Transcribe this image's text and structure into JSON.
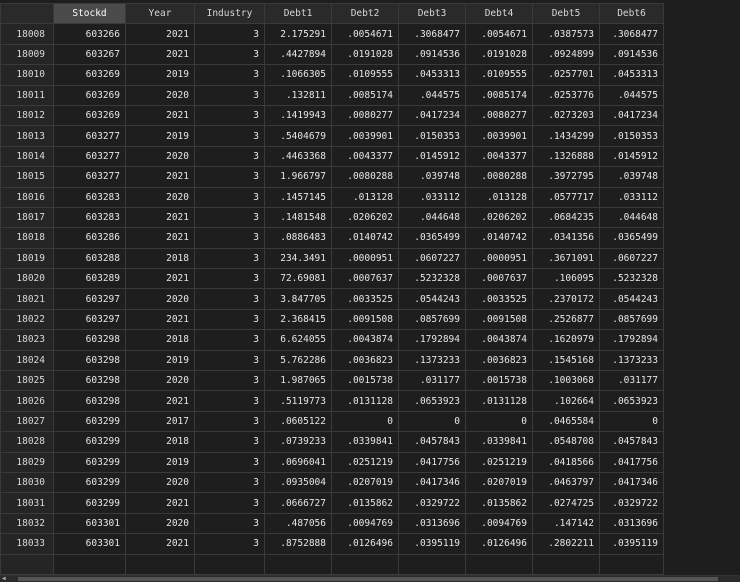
{
  "table": {
    "columns": [
      "",
      "Stockd",
      "Year",
      "Industry",
      "Debt1",
      "Debt2",
      "Debt3",
      "Debt4",
      "Debt5",
      "Debt6"
    ],
    "selected_column": 1,
    "rows": [
      [
        "18008",
        "603266",
        "2021",
        "3",
        "2.175291",
        ".0054671",
        ".3068477",
        ".0054671",
        ".0387573",
        ".3068477"
      ],
      [
        "18009",
        "603267",
        "2021",
        "3",
        ".4427894",
        ".0191028",
        ".0914536",
        ".0191028",
        ".0924899",
        ".0914536"
      ],
      [
        "18010",
        "603269",
        "2019",
        "3",
        ".1066305",
        ".0109555",
        ".0453313",
        ".0109555",
        ".0257701",
        ".0453313"
      ],
      [
        "18011",
        "603269",
        "2020",
        "3",
        ".132811",
        ".0085174",
        ".044575",
        ".0085174",
        ".0253776",
        ".044575"
      ],
      [
        "18012",
        "603269",
        "2021",
        "3",
        ".1419943",
        ".0080277",
        ".0417234",
        ".0080277",
        ".0273203",
        ".0417234"
      ],
      [
        "18013",
        "603277",
        "2019",
        "3",
        ".5404679",
        ".0039901",
        ".0150353",
        ".0039901",
        ".1434299",
        ".0150353"
      ],
      [
        "18014",
        "603277",
        "2020",
        "3",
        ".4463368",
        ".0043377",
        ".0145912",
        ".0043377",
        ".1326888",
        ".0145912"
      ],
      [
        "18015",
        "603277",
        "2021",
        "3",
        "1.966797",
        ".0080288",
        ".039748",
        ".0080288",
        ".3972795",
        ".039748"
      ],
      [
        "18016",
        "603283",
        "2020",
        "3",
        ".1457145",
        ".013128",
        ".033112",
        ".013128",
        ".0577717",
        ".033112"
      ],
      [
        "18017",
        "603283",
        "2021",
        "3",
        ".1481548",
        ".0206202",
        ".044648",
        ".0206202",
        ".0684235",
        ".044648"
      ],
      [
        "18018",
        "603286",
        "2021",
        "3",
        ".0886483",
        ".0140742",
        ".0365499",
        ".0140742",
        ".0341356",
        ".0365499"
      ],
      [
        "18019",
        "603288",
        "2018",
        "3",
        "234.3491",
        ".0000951",
        ".0607227",
        ".0000951",
        ".3671091",
        ".0607227"
      ],
      [
        "18020",
        "603289",
        "2021",
        "3",
        "72.69081",
        ".0007637",
        ".5232328",
        ".0007637",
        ".106095",
        ".5232328"
      ],
      [
        "18021",
        "603297",
        "2020",
        "3",
        "3.847705",
        ".0033525",
        ".0544243",
        ".0033525",
        ".2370172",
        ".0544243"
      ],
      [
        "18022",
        "603297",
        "2021",
        "3",
        "2.368415",
        ".0091508",
        ".0857699",
        ".0091508",
        ".2526877",
        ".0857699"
      ],
      [
        "18023",
        "603298",
        "2018",
        "3",
        "6.624055",
        ".0043874",
        ".1792894",
        ".0043874",
        ".1620979",
        ".1792894"
      ],
      [
        "18024",
        "603298",
        "2019",
        "3",
        "5.762286",
        ".0036823",
        ".1373233",
        ".0036823",
        ".1545168",
        ".1373233"
      ],
      [
        "18025",
        "603298",
        "2020",
        "3",
        "1.987065",
        ".0015738",
        ".031177",
        ".0015738",
        ".1003068",
        ".031177"
      ],
      [
        "18026",
        "603298",
        "2021",
        "3",
        ".5119773",
        ".0131128",
        ".0653923",
        ".0131128",
        ".102664",
        ".0653923"
      ],
      [
        "18027",
        "603299",
        "2017",
        "3",
        ".0605122",
        "0",
        "0",
        "0",
        ".0465584",
        "0"
      ],
      [
        "18028",
        "603299",
        "2018",
        "3",
        ".0739233",
        ".0339841",
        ".0457843",
        ".0339841",
        ".0548708",
        ".0457843"
      ],
      [
        "18029",
        "603299",
        "2019",
        "3",
        ".0696041",
        ".0251219",
        ".0417756",
        ".0251219",
        ".0418566",
        ".0417756"
      ],
      [
        "18030",
        "603299",
        "2020",
        "3",
        ".0935004",
        ".0207019",
        ".0417346",
        ".0207019",
        ".0463797",
        ".0417346"
      ],
      [
        "18031",
        "603299",
        "2021",
        "3",
        ".0666727",
        ".0135862",
        ".0329722",
        ".0135862",
        ".0274725",
        ".0329722"
      ],
      [
        "18032",
        "603301",
        "2020",
        "3",
        ".487056",
        ".0094769",
        ".0313696",
        ".0094769",
        ".147142",
        ".0313696"
      ],
      [
        "18033",
        "603301",
        "2021",
        "3",
        ".8752888",
        ".0126496",
        ".0395119",
        ".0126496",
        ".2802211",
        ".0395119"
      ],
      [
        "",
        "",
        "",
        "",
        "",
        "",
        "",
        "",
        "",
        ""
      ]
    ]
  },
  "scrollbar": {
    "arrow_icon": "chevron-left-icon"
  }
}
